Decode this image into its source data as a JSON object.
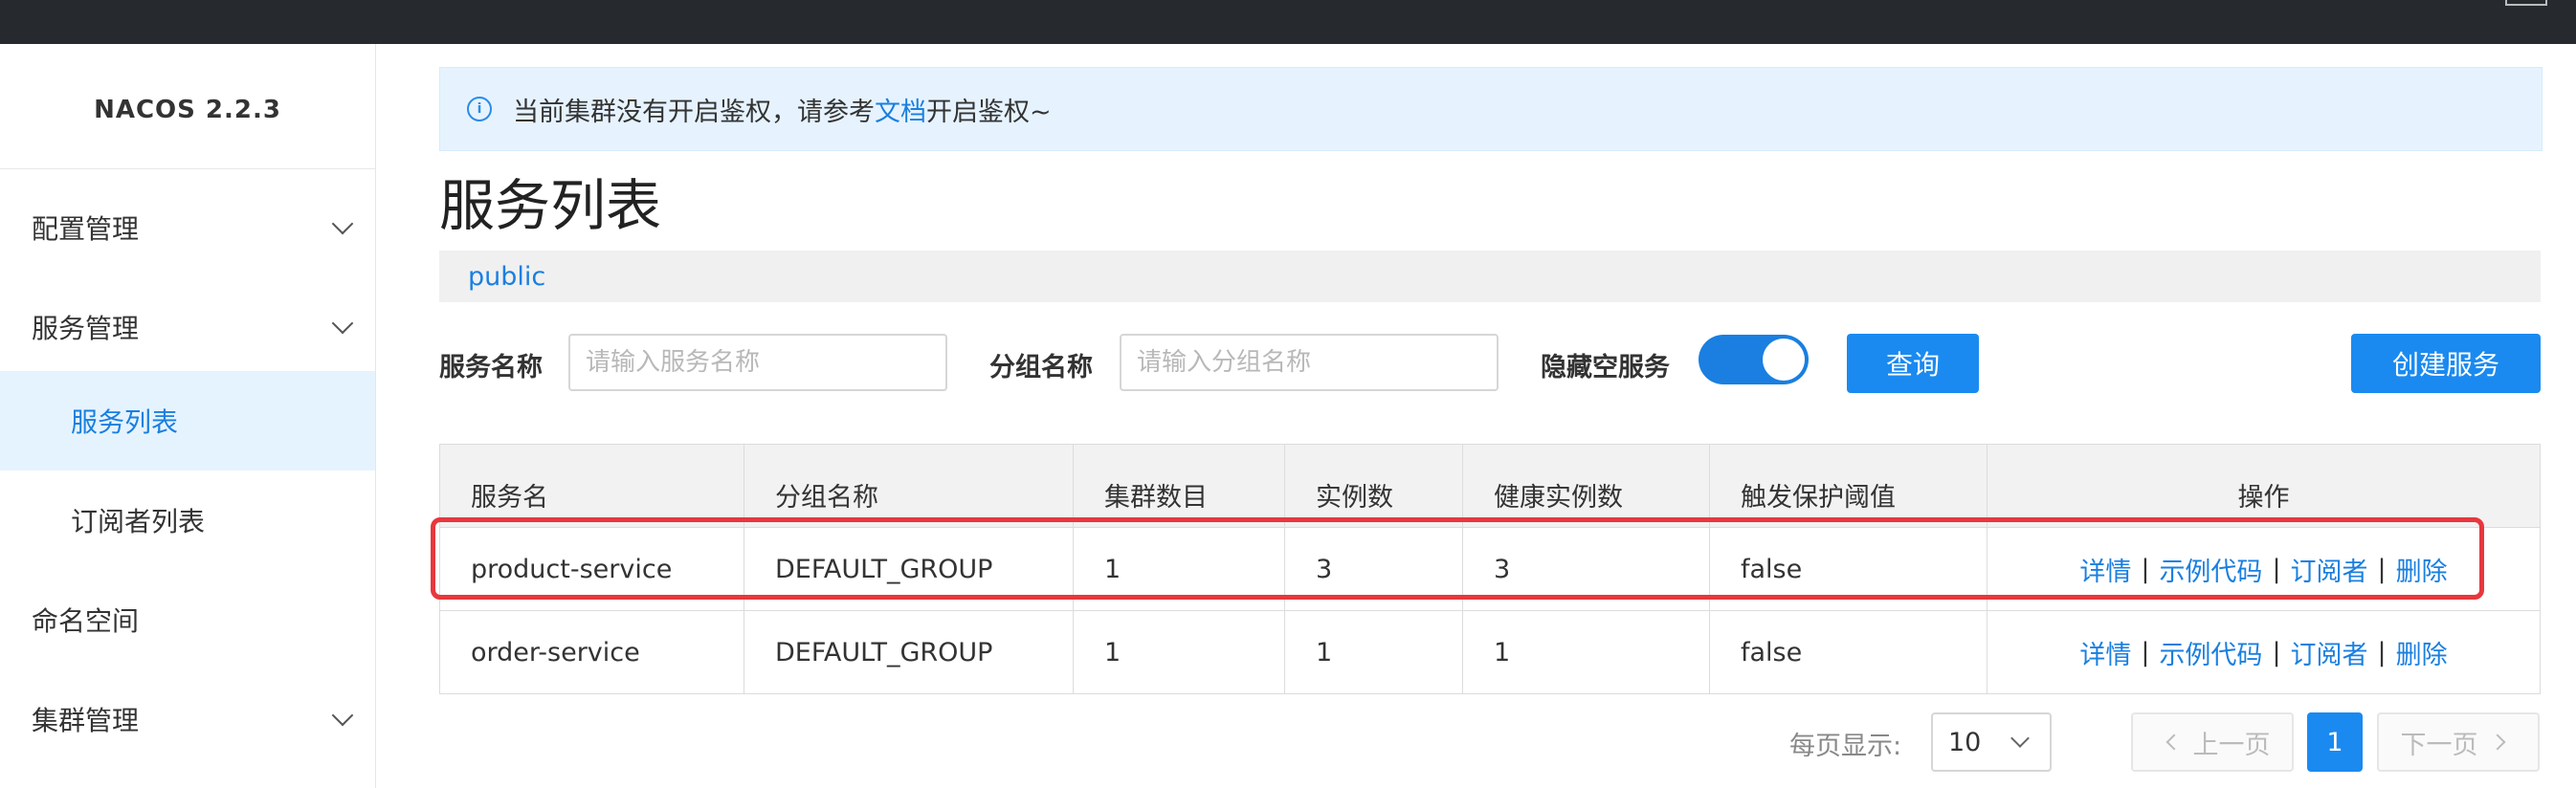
{
  "brand": "NACOS 2.2.3",
  "sidebar": {
    "items": [
      {
        "label": "配置管理",
        "icon": "chevron-down-icon"
      },
      {
        "label": "服务管理",
        "icon": "chevron-down-icon"
      },
      {
        "label": "服务列表",
        "active": true
      },
      {
        "label": "订阅者列表"
      },
      {
        "label": "命名空间"
      },
      {
        "label": "集群管理",
        "icon": "chevron-down-icon"
      }
    ]
  },
  "alert": {
    "icon": "info-icon",
    "text_before": "当前集群没有开启鉴权，请参考",
    "link": "文档",
    "text_after": "开启鉴权~"
  },
  "page_title": "服务列表",
  "namespace": "public",
  "filters": {
    "service_name_label": "服务名称",
    "service_name_placeholder": "请输入服务名称",
    "group_name_label": "分组名称",
    "group_name_placeholder": "请输入分组名称",
    "hide_empty_label": "隐藏空服务",
    "hide_empty_enabled": true,
    "query_button": "查询",
    "create_button": "创建服务"
  },
  "table": {
    "headers": [
      "服务名",
      "分组名称",
      "集群数目",
      "实例数",
      "健康实例数",
      "触发保护阈值",
      "操作"
    ],
    "rows": [
      {
        "name": "product-service",
        "group": "DEFAULT_GROUP",
        "clusters": "1",
        "instances": "3",
        "healthy": "3",
        "threshold": "false"
      },
      {
        "name": "order-service",
        "group": "DEFAULT_GROUP",
        "clusters": "1",
        "instances": "1",
        "healthy": "1",
        "threshold": "false"
      }
    ],
    "actions": {
      "detail": "详情",
      "sample": "示例代码",
      "subscribers": "订阅者",
      "delete": "删除",
      "separator": "|"
    }
  },
  "pagination": {
    "page_size_label": "每页显示:",
    "page_size": "10",
    "prev": "上一页",
    "current_page": "1",
    "next": "下一页"
  },
  "colors": {
    "accent": "#1a8af0",
    "highlight": "#e8373d",
    "topbar": "#262a2f"
  }
}
